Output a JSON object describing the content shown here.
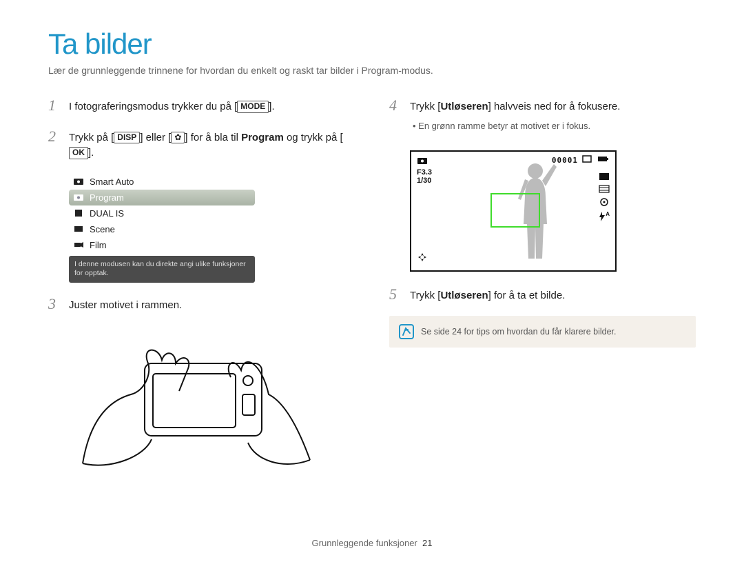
{
  "title": "Ta bilder",
  "subtitle": "Lær de grunnleggende trinnene for hvordan du enkelt og raskt tar bilder i Program-modus.",
  "steps": {
    "s1": {
      "num": "1",
      "pre": "I fotograferingsmodus trykker du på [",
      "btn": "MODE",
      "post": "]."
    },
    "s2": {
      "num": "2",
      "pre": "Trykk på [",
      "btn1": "DISP",
      "mid": "] eller [",
      "icon": "✿",
      "mid2": "] for å bla til ",
      "bold": "Program",
      "post": " og trykk på [",
      "btn2": "OK",
      "end": "]."
    },
    "s3": {
      "num": "3",
      "text": "Juster motivet i rammen."
    },
    "s4": {
      "num": "4",
      "pre": "Trykk [",
      "bold": "Utløseren",
      "post": "] halvveis ned for å fokusere."
    },
    "s4_sub": "•  En grønn ramme betyr at motivet er i fokus.",
    "s5": {
      "num": "5",
      "pre": "Trykk [",
      "bold": "Utløseren",
      "post": "] for å ta et bilde."
    }
  },
  "mode_menu": {
    "items": [
      {
        "label": "Smart Auto"
      },
      {
        "label": "Program",
        "selected": true
      },
      {
        "label": "DUAL IS"
      },
      {
        "label": "Scene"
      },
      {
        "label": "Film"
      }
    ],
    "desc": "I denne modusen kan du direkte angi ulike funksjoner for opptak."
  },
  "screen": {
    "counter": "00001",
    "aperture": "F3.3",
    "shutter": "1/30",
    "flash": "A"
  },
  "tip": "Se side 24 for tips om hvordan du får klarere bilder.",
  "footer": {
    "label": "Grunnleggende funksjoner",
    "page": "21"
  }
}
